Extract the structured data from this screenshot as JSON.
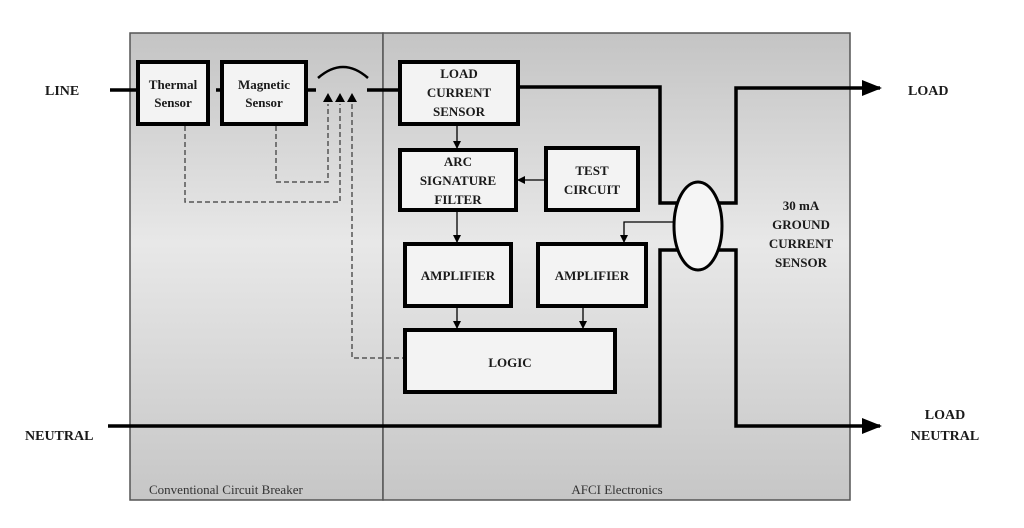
{
  "diagram": {
    "sections": {
      "conventional": "Conventional Circuit Breaker",
      "afci": "AFCI Electronics"
    },
    "terminals": {
      "line": "LINE",
      "neutral": "NEUTRAL",
      "load": "LOAD",
      "load_neutral": [
        "LOAD",
        "NEUTRAL"
      ]
    },
    "blocks": {
      "thermal": [
        "Thermal",
        "Sensor"
      ],
      "magnetic": [
        "Magnetic",
        "Sensor"
      ],
      "load_current": [
        "LOAD",
        "CURRENT",
        "SENSOR"
      ],
      "arc_filter": [
        "ARC",
        "SIGNATURE",
        "FILTER"
      ],
      "test_circuit": [
        "TEST",
        "CIRCUIT"
      ],
      "amplifier_left": "AMPLIFIER",
      "amplifier_right": "AMPLIFIER",
      "logic": "LOGIC"
    },
    "ground_sensor": [
      "30 mA",
      "GROUND",
      "CURRENT",
      "SENSOR"
    ],
    "colors": {
      "panel_top": "#c4c4c4",
      "panel_mid": "#e6e6e6",
      "panel_bottom": "#c8c8c8",
      "box_fill": "#f3f3f3",
      "wire": "#000000",
      "dashed": "#555555"
    }
  }
}
